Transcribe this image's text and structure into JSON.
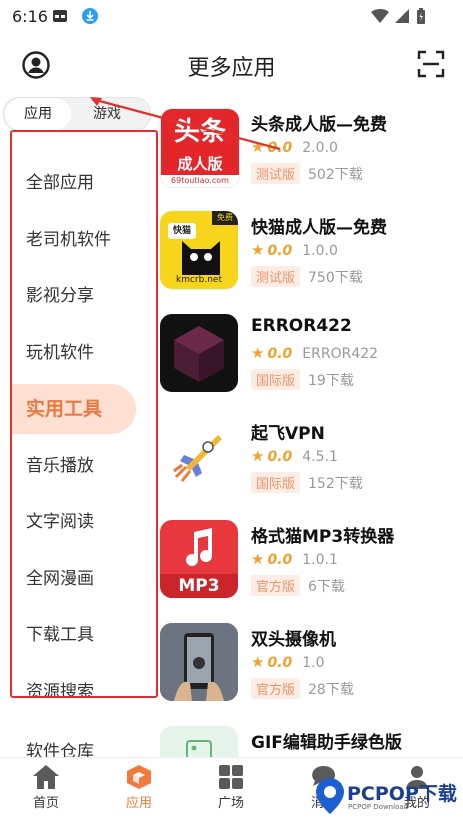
{
  "status_bar": {
    "time": "6:16"
  },
  "header": {
    "title": "更多应用"
  },
  "tabs": [
    {
      "label": "应用",
      "active": true
    },
    {
      "label": "游戏",
      "active": false
    }
  ],
  "categories": [
    {
      "label": "全部应用"
    },
    {
      "label": "老司机软件"
    },
    {
      "label": "影视分享"
    },
    {
      "label": "玩机软件"
    },
    {
      "label": "实用工具",
      "active": true
    },
    {
      "label": "音乐播放"
    },
    {
      "label": "文字阅读"
    },
    {
      "label": "全网漫画"
    },
    {
      "label": "下载工具"
    },
    {
      "label": "资源搜索"
    }
  ],
  "extra_category": "软件仓库",
  "apps": [
    {
      "name": "头条成人版—免费",
      "score": "0.0",
      "version": "2.0.0",
      "tag": "测试版",
      "downloads": "502下载",
      "icon": "toutiao-icon",
      "icon_text": "头条",
      "icon_sub": "成人版",
      "icon_url": "69toutiao.com"
    },
    {
      "name": "快猫成人版—免费",
      "score": "0.0",
      "version": "1.0.0",
      "tag": "测试版",
      "downloads": "750下载",
      "icon": "kuaimao-cat-icon",
      "icon_url": "kmcrb.net",
      "icon_badge": "快猫",
      "icon_corner": "免费"
    },
    {
      "name": "ERROR422",
      "score": "0.0",
      "version": "ERROR422",
      "tag": "国际版",
      "downloads": "19下载",
      "icon": "error-cube-icon"
    },
    {
      "name": "起飞VPN",
      "score": "0.0",
      "version": "4.5.1",
      "tag": "国际版",
      "downloads": "152下载",
      "icon": "rocket-icon"
    },
    {
      "name": "格式猫MP3转换器",
      "score": "0.0",
      "version": "1.0.1",
      "tag": "官方版",
      "downloads": "6下载",
      "icon": "mp3-music-icon",
      "icon_text": "MP3"
    },
    {
      "name": "双头摄像机",
      "score": "0.0",
      "version": "1.0",
      "tag": "官方版",
      "downloads": "28下载",
      "icon": "dual-camera-icon"
    },
    {
      "name": "GIF编辑助手绿色版",
      "icon": "gif-icon"
    }
  ],
  "bottom_nav": [
    {
      "label": "首页",
      "icon": "home-icon"
    },
    {
      "label": "应用",
      "icon": "apps-cube-icon",
      "active": true
    },
    {
      "label": "广场",
      "icon": "grid-icon"
    },
    {
      "label": "消息",
      "icon": "message-icon"
    },
    {
      "label": "我的",
      "icon": "person-icon"
    }
  ],
  "watermark": {
    "text": "PCPOP下载",
    "sub": "PCPOP Download"
  },
  "colors": {
    "accent": "#f07a3e",
    "annotation_red": "#e0302e",
    "star": "#f2a12c"
  }
}
